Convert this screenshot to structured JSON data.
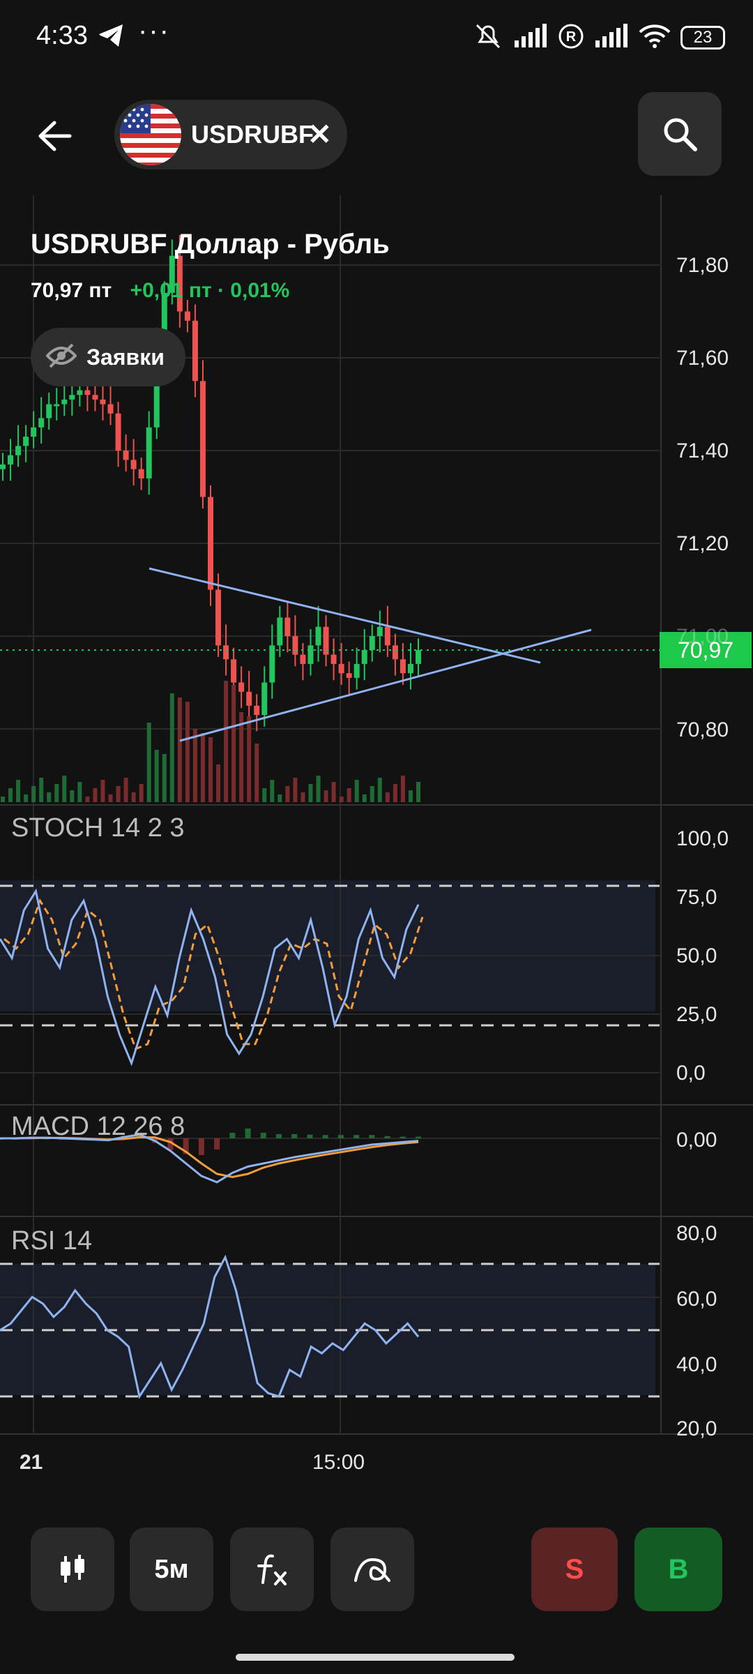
{
  "status_bar": {
    "time": "4:33",
    "more": "···",
    "battery": "23"
  },
  "header": {
    "ticker": "USDRUBF"
  },
  "instrument": {
    "title": "USDRUBF Доллар - Рубль",
    "price": "70,97 пт",
    "change": "+0,01 пт · 0,01%"
  },
  "orders_toggle": {
    "label": "Заявки"
  },
  "price_axis": {
    "labels": [
      "71,80",
      "71,60",
      "71,40",
      "71,20",
      "71,00",
      "70,80"
    ],
    "current": "70,97"
  },
  "indicators": {
    "stoch": {
      "label": "STOCH 14 2 3",
      "ticks": [
        "100,0",
        "75,0",
        "50,0",
        "25,0",
        "0,0"
      ]
    },
    "macd": {
      "label": "MACD 12 26 8",
      "ticks": [
        "0,00"
      ]
    },
    "rsi": {
      "label": "RSI 14",
      "ticks": [
        "80,0",
        "60,0",
        "40,0",
        "20,0"
      ]
    }
  },
  "time_axis": {
    "labels": [
      "21",
      "15:00"
    ]
  },
  "toolbar": {
    "interval": "5м",
    "sell": "S",
    "buy": "B"
  },
  "colors": {
    "up": "#22c55e",
    "down": "#ef5350",
    "accent_line": "#8fb3f0",
    "stoch_signal": "#f39c3a"
  },
  "chart_data": [
    {
      "type": "candlestick",
      "title": "USDRUBF Доллар - Рубль",
      "x": [
        "21",
        "15:00"
      ],
      "ylim": [
        70.7,
        71.9
      ],
      "closes_approx": [
        71.37,
        71.39,
        71.41,
        71.43,
        71.45,
        71.47,
        71.5,
        71.5,
        71.51,
        71.52,
        71.53,
        71.52,
        71.51,
        71.5,
        71.48,
        71.4,
        71.38,
        71.36,
        71.34,
        71.45,
        71.62,
        71.74,
        71.82,
        71.7,
        71.68,
        71.55,
        71.3,
        71.1,
        70.98,
        70.95,
        70.9,
        70.88,
        70.85,
        70.83,
        70.9,
        70.98,
        71.04,
        71.0,
        70.96,
        70.94,
        70.98,
        71.02,
        70.96,
        70.94,
        70.92,
        70.91,
        70.94,
        70.97,
        71.0,
        71.02,
        70.98,
        70.95,
        70.92,
        70.94,
        70.97
      ]
    },
    {
      "type": "line",
      "title": "STOCH 14 2 3",
      "ylim": [
        0,
        100
      ],
      "levels": [
        80,
        20
      ]
    },
    {
      "type": "line",
      "title": "MACD 12 26 8"
    },
    {
      "type": "line",
      "title": "RSI 14",
      "ylim": [
        20,
        80
      ],
      "levels": [
        70,
        50,
        30
      ]
    }
  ]
}
